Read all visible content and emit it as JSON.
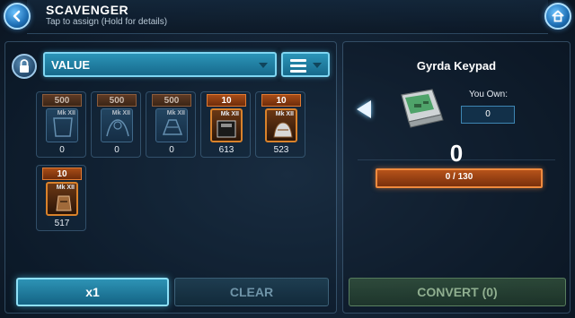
{
  "header": {
    "title": "SCAVENGER",
    "subtitle": "Tap to assign (Hold for details)",
    "back_icon": "chevron-left-icon",
    "home_icon": "home-icon"
  },
  "toolbar": {
    "lock_icon": "lock-icon",
    "sort_value": "VALUE",
    "filter_icon": "list-filter-icon"
  },
  "items": [
    {
      "cost": "500",
      "level": "Mk XII",
      "count": "0",
      "owned": false
    },
    {
      "cost": "500",
      "level": "Mk XII",
      "count": "0",
      "owned": false
    },
    {
      "cost": "500",
      "level": "Mk XII",
      "count": "0",
      "owned": false
    },
    {
      "cost": "10",
      "level": "Mk XII",
      "count": "613",
      "owned": true
    },
    {
      "cost": "10",
      "level": "Mk XII",
      "count": "523",
      "owned": true
    },
    {
      "cost": "10",
      "level": "Mk XII",
      "count": "517",
      "owned": true
    }
  ],
  "actions": {
    "quantity_label": "x1",
    "clear_label": "CLEAR",
    "convert_label": "CONVERT (0)"
  },
  "detail": {
    "item_name": "Gyrda Keypad",
    "you_own_label": "You Own:",
    "you_own_value": "0",
    "selected_count": "0",
    "progress_text": "0 / 130",
    "progress_fraction": 0
  },
  "colors": {
    "accent_blue": "#2b94b8",
    "accent_orange": "#f08a3e",
    "convert_green": "#8fae8f"
  }
}
